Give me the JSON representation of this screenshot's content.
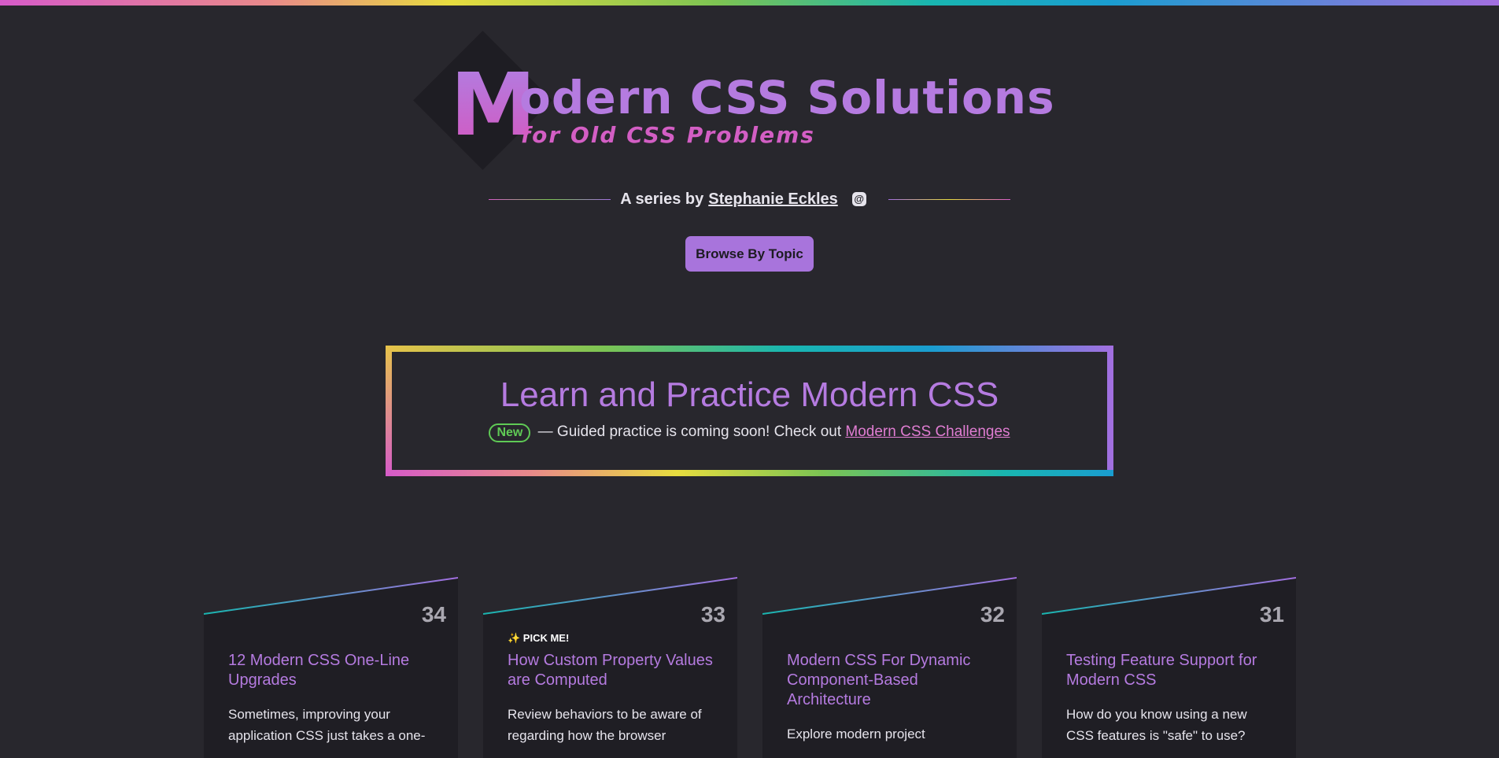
{
  "header": {
    "logo_initial": "M",
    "logo_rest": "odern CSS Solutions",
    "logo_sub": "for Old CSS Problems",
    "byline_prefix": "A series by",
    "author": "Stephanie Eckles",
    "browse_button": "Browse By Topic"
  },
  "practice": {
    "title": "Learn and Practice Modern CSS",
    "badge": "New",
    "text": "— Guided practice is coming soon! Check out",
    "link": "Modern CSS Challenges"
  },
  "cards": [
    {
      "number": "34",
      "pick": "",
      "title": "12 Modern CSS One-Line Upgrades",
      "desc": "Sometimes, improving your application CSS just takes a one-"
    },
    {
      "number": "33",
      "pick": "✨ PICK ME!",
      "title": "How Custom Property Values are Computed",
      "desc": "Review behaviors to be aware of regarding how the browser"
    },
    {
      "number": "32",
      "pick": "",
      "title": "Modern CSS For Dynamic Component-Based Architecture",
      "desc": "Explore modern project"
    },
    {
      "number": "31",
      "pick": "",
      "title": "Testing Feature Support for Modern CSS",
      "desc": "How do you know using a new CSS features is \"safe\" to use?"
    }
  ],
  "colors": {
    "background": "#28272d",
    "accent_purple": "#b57be0",
    "accent_pink": "#d35ec4",
    "badge_green": "#5fca55"
  },
  "icons": [
    "mastodon-icon"
  ]
}
